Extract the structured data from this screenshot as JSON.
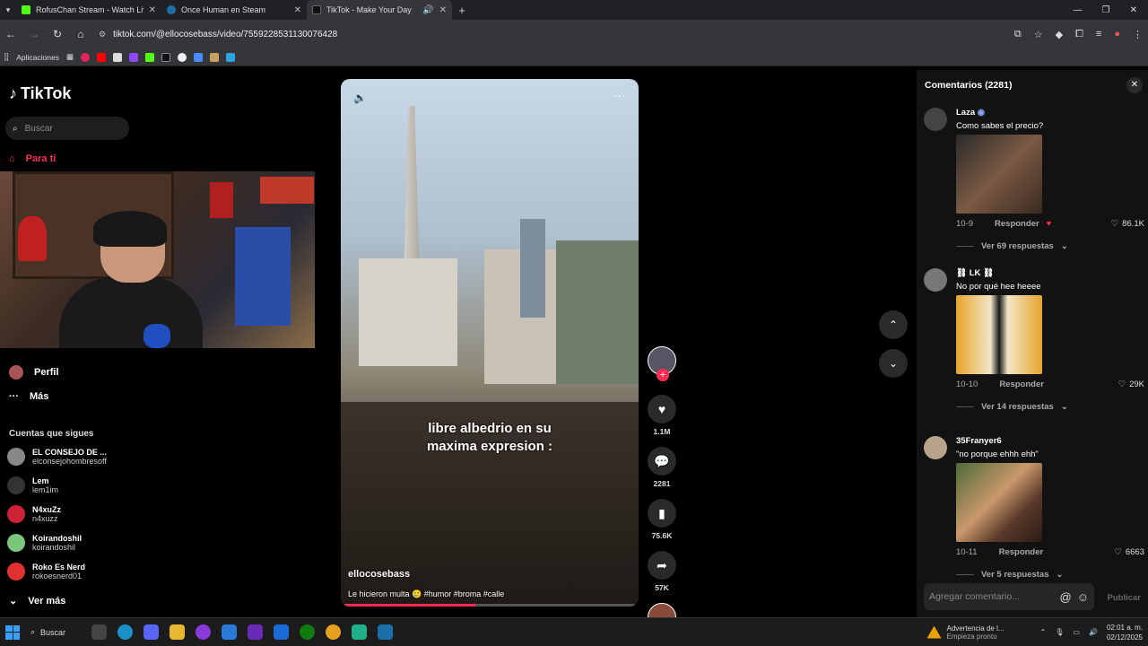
{
  "browser": {
    "tabs": [
      {
        "title": "RofusChan Stream - Watch Live",
        "color": "#53fc18"
      },
      {
        "title": "Once Human en Steam",
        "color": "#1b2838"
      },
      {
        "title": "TikTok - Make Your Day",
        "color": "#111111",
        "active": true
      }
    ],
    "url": "tiktok.com/@ellocosebass/video/7559228531130076428",
    "bookmarks_label": "Aplicaciones"
  },
  "sidebar": {
    "logo": "TikTok",
    "search_placeholder": "Buscar",
    "for_you": "Para ti",
    "profile": "Perfil",
    "more": "Más",
    "following_header": "Cuentas que sigues",
    "accounts": [
      {
        "name": "EL CONSEJO DE ...",
        "handle": "elconsejohombresoff",
        "color": "#888888"
      },
      {
        "name": "Lem",
        "handle": "lem1im",
        "color": "#333333"
      },
      {
        "name": "N4xuZz",
        "handle": "n4xuzz",
        "color": "#cc2233"
      },
      {
        "name": "Koirandoshil",
        "handle": "koirandoshil",
        "color": "#7bc67b"
      },
      {
        "name": "Roko Es Nerd",
        "handle": "rokoesnerd01",
        "color": "#e03030"
      }
    ],
    "see_more": "Ver más"
  },
  "video": {
    "caption_line1": "libre albedrio en su",
    "caption_line2": "maxima expresion :",
    "username": "ellocosebass",
    "description": "Le hicieron multa 🥲 #humor #broma #calle",
    "progress": 0.45,
    "likes": "1.1M",
    "comments": "2281",
    "saves": "75.6K",
    "shares": "57K"
  },
  "comments_panel": {
    "header": "Comentarios (2281)",
    "items": [
      {
        "user": "Laza",
        "text": "Como sabes el precio?",
        "date": "10-9",
        "likes": "86.1K",
        "replies": "Ver 69 respuestas",
        "avatar": "#444444",
        "img": "#5a4030"
      },
      {
        "user": "⛓ LK ⛓",
        "text": "No por qué hee heeee",
        "date": "10-10",
        "likes": "29K",
        "replies": "Ver 14 respuestas",
        "avatar": "#777777",
        "img": "#e6a52a"
      },
      {
        "user": "35Franyer6",
        "text": "\"no porque ehhh ehh\"",
        "date": "10-11",
        "likes": "6663",
        "replies": "Ver 5 respuestas",
        "avatar": "#b9a38a",
        "img": "#7a5a4a"
      }
    ],
    "reply_label": "Responder",
    "input_placeholder": "Agregar comentario...",
    "publish": "Publicar"
  },
  "taskbar": {
    "search": "Buscar",
    "alert_title": "Advertencia de l...",
    "alert_sub": "Empieza pronto",
    "time": "02:01 a. m.",
    "date": "02/12/2025"
  }
}
